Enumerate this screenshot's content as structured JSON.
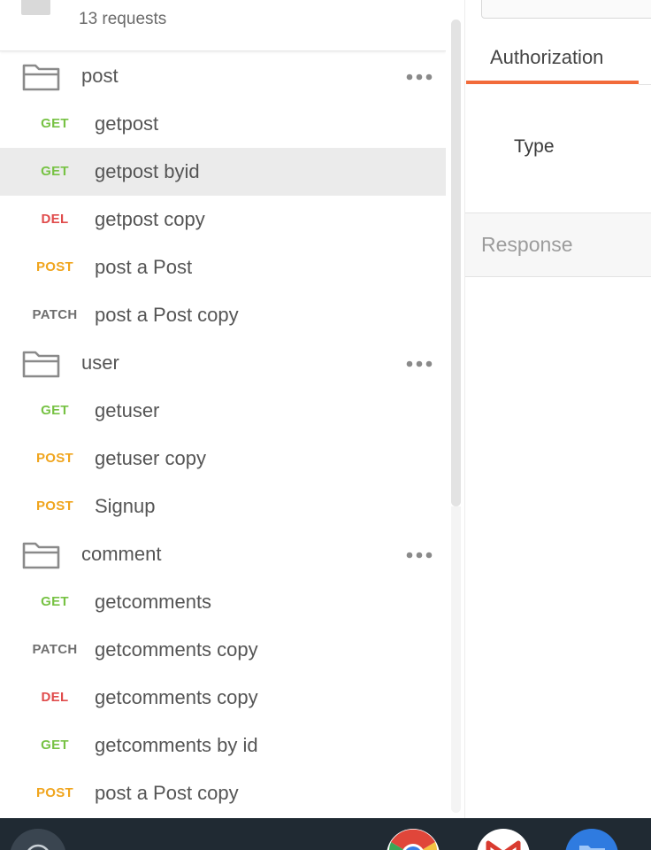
{
  "header": {
    "request_count": "13 requests"
  },
  "methods": {
    "GET": "#77c244",
    "DEL": "#e04b4b",
    "POST": "#f0a51e",
    "PATCH": "#707070"
  },
  "collection": [
    {
      "kind": "folder",
      "name": "post"
    },
    {
      "kind": "request",
      "method": "GET",
      "name": "getpost"
    },
    {
      "kind": "request",
      "method": "GET",
      "name": "getpost byid",
      "selected": true
    },
    {
      "kind": "request",
      "method": "DEL",
      "name": "getpost copy"
    },
    {
      "kind": "request",
      "method": "POST",
      "name": "post a Post"
    },
    {
      "kind": "request",
      "method": "PATCH",
      "name": "post a Post copy"
    },
    {
      "kind": "folder",
      "name": "user"
    },
    {
      "kind": "request",
      "method": "GET",
      "name": "getuser"
    },
    {
      "kind": "request",
      "method": "POST",
      "name": "getuser copy"
    },
    {
      "kind": "request",
      "method": "POST",
      "name": "Signup"
    },
    {
      "kind": "folder",
      "name": "comment"
    },
    {
      "kind": "request",
      "method": "GET",
      "name": "getcomments"
    },
    {
      "kind": "request",
      "method": "PATCH",
      "name": "getcomments copy"
    },
    {
      "kind": "request",
      "method": "DEL",
      "name": "getcomments copy"
    },
    {
      "kind": "request",
      "method": "GET",
      "name": "getcomments by id"
    },
    {
      "kind": "request",
      "method": "POST",
      "name": "post a Post copy"
    }
  ],
  "right_panel": {
    "active_tab": "Authorization",
    "type_label": "Type",
    "response_label": "Response",
    "accent_color": "#f26b3a"
  },
  "taskbar": {
    "icons": [
      "launcher-icon",
      "chrome-icon",
      "gmail-icon",
      "files-icon"
    ]
  }
}
